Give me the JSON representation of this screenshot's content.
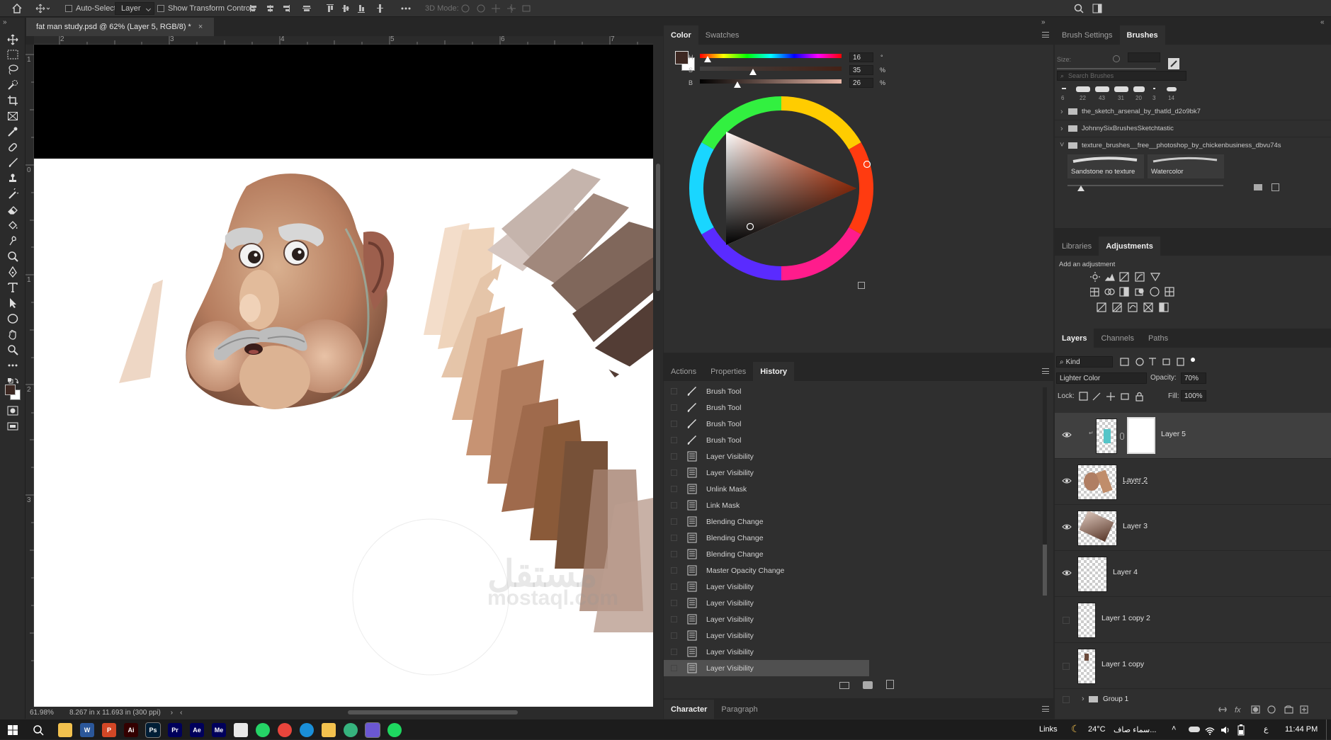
{
  "options_bar": {
    "auto_select_label": "Auto-Select:",
    "auto_select_target": "Layer",
    "show_transform_label": "Show Transform Controls",
    "mode_3d_label": "3D Mode:"
  },
  "document": {
    "tab_title": "fat man study.psd @ 62% (Layer 5, RGB/8) *",
    "ruler_top": [
      "2",
      "3",
      "4",
      "5",
      "6",
      "7"
    ],
    "ruler_left": [
      "1",
      "0",
      "1",
      "2",
      "3"
    ],
    "zoom": "61.98%",
    "doc_info": "8.267 in x 11.693 in (300 ppi)"
  },
  "color_panel": {
    "tabs": [
      "Color",
      "Swatches"
    ],
    "active_tab": "Color",
    "h_label": "H",
    "s_label": "S",
    "b_label": "B",
    "h_value": "16",
    "s_value": "35",
    "b_value": "26",
    "h_unit": "°",
    "s_unit": "%",
    "b_unit": "%",
    "foreground_color": "#3d2822",
    "background_color": "#ffffff",
    "hue_color": "#ff4a10"
  },
  "brushes_panel": {
    "tabs": [
      "Brush Settings",
      "Brushes"
    ],
    "active_tab": "Brushes",
    "size_label": "Size:",
    "search_placeholder": "Search Brushes",
    "recent_sizes": [
      "6",
      "22",
      "43",
      "31",
      "20",
      "3",
      "14"
    ],
    "folders": [
      {
        "name": "the_sketch_arsenal_by_thatld_d2o9bk7",
        "expanded": false
      },
      {
        "name": "JohnnySixBrushesSketchtastic",
        "expanded": false
      },
      {
        "name": "texture_brushes__free__photoshop_by_chickenbusiness_dbvu74s",
        "expanded": true
      }
    ],
    "brushes": [
      "Sandstone no texture",
      "Watercolor"
    ]
  },
  "adjustments_panel": {
    "tabs": [
      "Libraries",
      "Adjustments"
    ],
    "active_tab": "Adjustments",
    "add_label": "Add an adjustment"
  },
  "history_panel": {
    "tabs": [
      "Actions",
      "Properties",
      "History"
    ],
    "active_tab": "History",
    "items": [
      {
        "label": "Brush Tool",
        "icon": "brush-icon"
      },
      {
        "label": "Brush Tool",
        "icon": "brush-icon"
      },
      {
        "label": "Brush Tool",
        "icon": "brush-icon"
      },
      {
        "label": "Brush Tool",
        "icon": "brush-icon"
      },
      {
        "label": "Layer Visibility",
        "icon": "history-state-icon"
      },
      {
        "label": "Layer Visibility",
        "icon": "history-state-icon"
      },
      {
        "label": "Unlink Mask",
        "icon": "history-state-icon"
      },
      {
        "label": "Link Mask",
        "icon": "history-state-icon"
      },
      {
        "label": "Blending Change",
        "icon": "history-state-icon"
      },
      {
        "label": "Blending Change",
        "icon": "history-state-icon"
      },
      {
        "label": "Blending Change",
        "icon": "history-state-icon"
      },
      {
        "label": "Master Opacity Change",
        "icon": "history-state-icon"
      },
      {
        "label": "Layer Visibility",
        "icon": "history-state-icon"
      },
      {
        "label": "Layer Visibility",
        "icon": "history-state-icon"
      },
      {
        "label": "Layer Visibility",
        "icon": "history-state-icon"
      },
      {
        "label": "Layer Visibility",
        "icon": "history-state-icon"
      },
      {
        "label": "Layer Visibility",
        "icon": "history-state-icon"
      },
      {
        "label": "Layer Visibility",
        "icon": "history-state-icon"
      }
    ],
    "selected_index": 17
  },
  "character_panel": {
    "tabs": [
      "Character",
      "Paragraph"
    ],
    "active_tab": "Character"
  },
  "layers_panel": {
    "tabs": [
      "Layers",
      "Channels",
      "Paths"
    ],
    "active_tab": "Layers",
    "filter_label": "Kind",
    "blend_mode": "Lighter Color",
    "opacity_label": "Opacity:",
    "opacity_value": "70%",
    "lock_label": "Lock:",
    "fill_label": "Fill:",
    "fill_value": "100%",
    "layers": [
      {
        "name": "Layer 5",
        "visible": true,
        "selected": true
      },
      {
        "name": "Layer 2",
        "visible": true,
        "selected": false
      },
      {
        "name": "Layer 3",
        "visible": true,
        "selected": false
      },
      {
        "name": "Layer 4",
        "visible": true,
        "selected": false
      },
      {
        "name": "Layer 1 copy 2",
        "visible": false,
        "selected": false
      },
      {
        "name": "Layer 1 copy",
        "visible": false,
        "selected": false
      },
      {
        "name": "Group 1",
        "visible": false,
        "selected": false
      }
    ]
  },
  "watermark": {
    "text": "mostaql.com",
    "arabic": "مستقل"
  },
  "taskbar": {
    "apps": [
      {
        "name": "file-explorer",
        "label": "",
        "color": "#f2c14e"
      },
      {
        "name": "word",
        "label": "W",
        "color": "#2b579a"
      },
      {
        "name": "powerpoint",
        "label": "P",
        "color": "#d24726"
      },
      {
        "name": "illustrator",
        "label": "Ai",
        "color": "#330000"
      },
      {
        "name": "photoshop",
        "label": "Ps",
        "color": "#001e36"
      },
      {
        "name": "premiere",
        "label": "Pr",
        "color": "#00005b"
      },
      {
        "name": "after-effects",
        "label": "Ae",
        "color": "#00005b"
      },
      {
        "name": "media-encoder",
        "label": "Me",
        "color": "#00005b"
      },
      {
        "name": "app-v",
        "label": "",
        "color": "#e8e8e8"
      },
      {
        "name": "whatsapp",
        "label": "",
        "color": "#25d366"
      },
      {
        "name": "chrome",
        "label": "",
        "color": "#e8453c"
      },
      {
        "name": "edge",
        "label": "",
        "color": "#1a8fd8"
      },
      {
        "name": "app-leaf",
        "label": "",
        "color": "#f2c14e"
      },
      {
        "name": "app-green",
        "label": "",
        "color": "#36b37e"
      },
      {
        "name": "app-purple",
        "label": "",
        "color": "#6b57d2"
      },
      {
        "name": "spotify",
        "label": "",
        "color": "#1ed760"
      }
    ],
    "links_label": "Links",
    "weather": "24°C",
    "weather_desc": "سماء صاف...",
    "lang": "ع",
    "time": "11:44 PM"
  }
}
